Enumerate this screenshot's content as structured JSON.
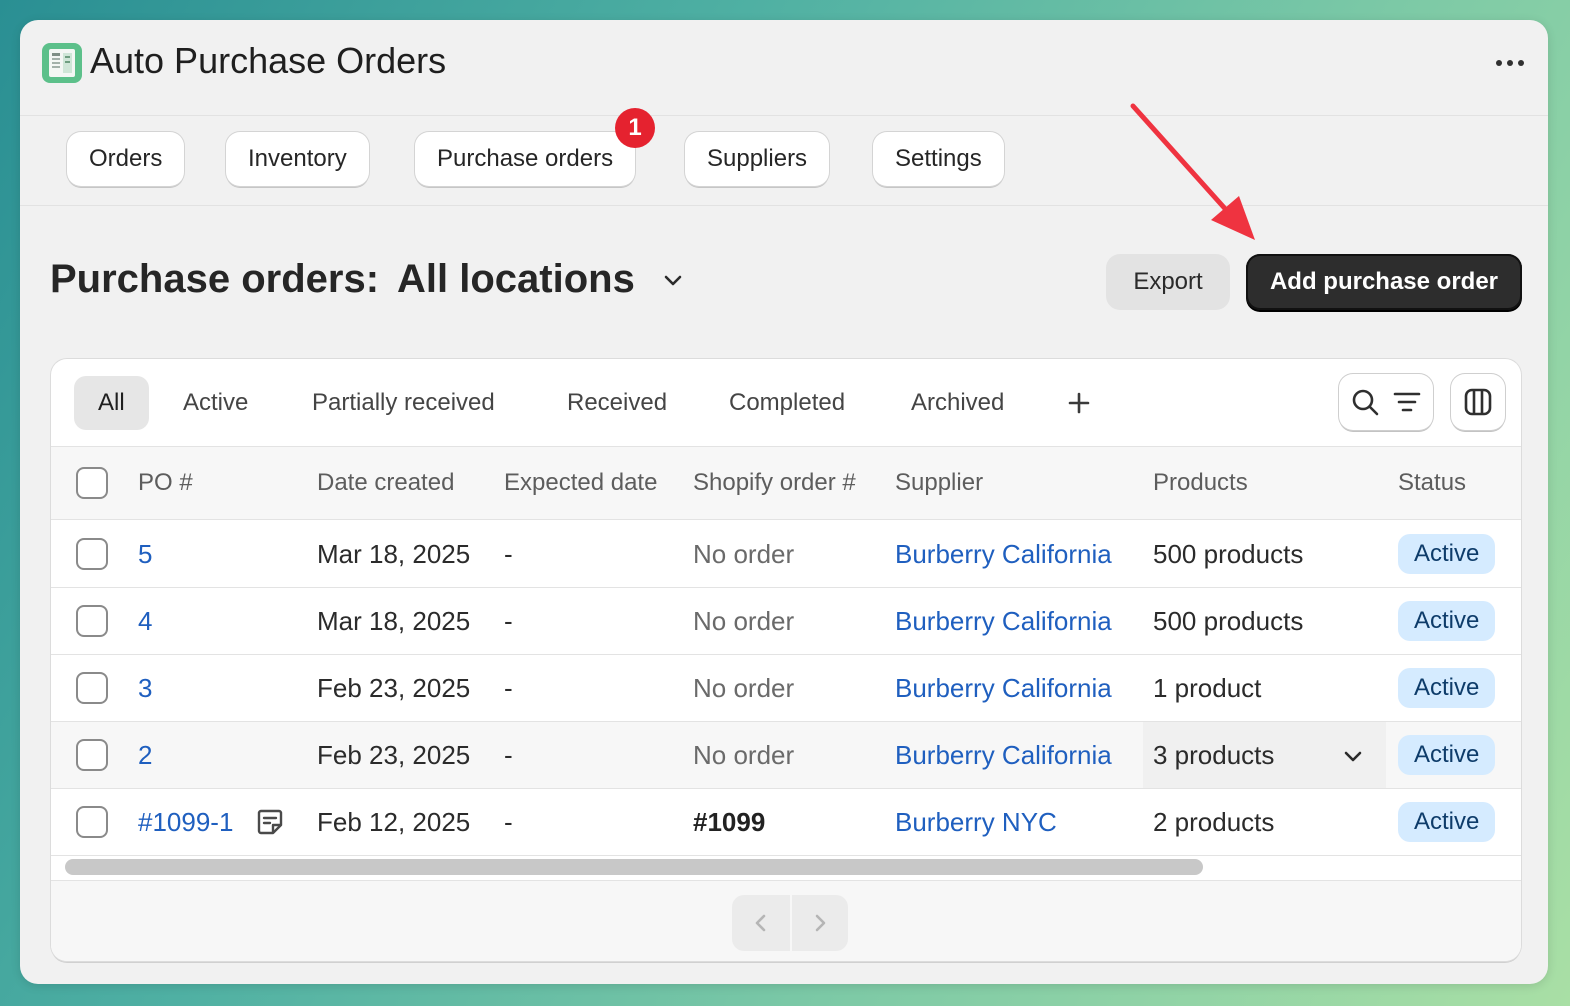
{
  "app": {
    "title": "Auto Purchase Orders",
    "icon": "spreadsheet-icon",
    "menu_icon": "more-horizontal-icon"
  },
  "nav": {
    "items": [
      {
        "label": "Orders"
      },
      {
        "label": "Inventory"
      },
      {
        "label": "Purchase orders"
      },
      {
        "label": "Suppliers"
      },
      {
        "label": "Settings"
      }
    ],
    "badge": "1"
  },
  "page": {
    "title": "Purchase orders:",
    "location": "All locations",
    "export_label": "Export",
    "add_label": "Add purchase order"
  },
  "filters": {
    "tabs": [
      {
        "label": "All",
        "selected": true
      },
      {
        "label": "Active"
      },
      {
        "label": "Partially received"
      },
      {
        "label": "Received"
      },
      {
        "label": "Completed"
      },
      {
        "label": "Archived"
      }
    ]
  },
  "table": {
    "columns": [
      "PO #",
      "Date created",
      "Expected date",
      "Shopify order #",
      "Supplier",
      "Products",
      "Status"
    ],
    "rows": [
      {
        "po": "5",
        "date": "Mar 18, 2025",
        "expected": "-",
        "order": "No order",
        "supplier": "Burberry California",
        "products": "500 products",
        "status": "Active"
      },
      {
        "po": "4",
        "date": "Mar 18, 2025",
        "expected": "-",
        "order": "No order",
        "supplier": "Burberry California",
        "products": "500 products",
        "status": "Active"
      },
      {
        "po": "3",
        "date": "Feb 23, 2025",
        "expected": "-",
        "order": "No order",
        "supplier": "Burberry California",
        "products": "1 product",
        "status": "Active"
      },
      {
        "po": "2",
        "date": "Feb 23, 2025",
        "expected": "-",
        "order": "No order",
        "supplier": "Burberry California",
        "products": "3 products",
        "status": "Active"
      },
      {
        "po": "#1099-1",
        "date": "Feb 12, 2025",
        "expected": "-",
        "order": "#1099",
        "supplier": "Burberry NYC",
        "products": "2 products",
        "status": "Active"
      }
    ]
  },
  "colors": {
    "accent_dark": "#2d2d2d",
    "link": "#1f5fbf",
    "badge_red": "#e5222f",
    "status_bg": "#d5ebff",
    "annotation_arrow": "#ef3340"
  }
}
